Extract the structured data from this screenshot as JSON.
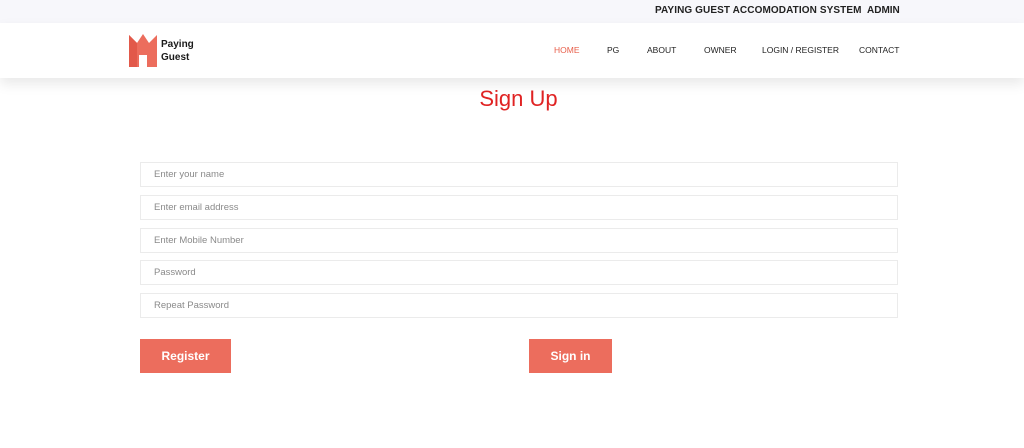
{
  "topbar": {
    "system_name": "PAYING GUEST ACCOMODATION SYSTEM",
    "admin_link": "ADMIN"
  },
  "brand": {
    "name_line1": "Paying",
    "name_line2": "Guest",
    "logo_icon": "house-crown-icon",
    "logo_color": "#ec6d5d"
  },
  "nav": {
    "items": [
      {
        "label": "HOME",
        "active": true
      },
      {
        "label": "PG",
        "active": false
      },
      {
        "label": "ABOUT",
        "active": false
      },
      {
        "label": "OWNER",
        "active": false
      },
      {
        "label": "LOGIN / REGISTER",
        "active": false
      },
      {
        "label": "CONTACT",
        "active": false
      }
    ],
    "active_color": "#e8604c"
  },
  "form": {
    "title": "Sign Up",
    "fields": [
      {
        "placeholder": "Enter your name",
        "value": ""
      },
      {
        "placeholder": "Enter email address",
        "value": ""
      },
      {
        "placeholder": "Enter Mobile Number",
        "value": ""
      },
      {
        "placeholder": "Password",
        "value": ""
      },
      {
        "placeholder": "Repeat Password",
        "value": ""
      }
    ],
    "register_label": "Register",
    "signin_label": "Sign in",
    "button_color": "#ec6d5d",
    "title_color": "#e02323"
  }
}
